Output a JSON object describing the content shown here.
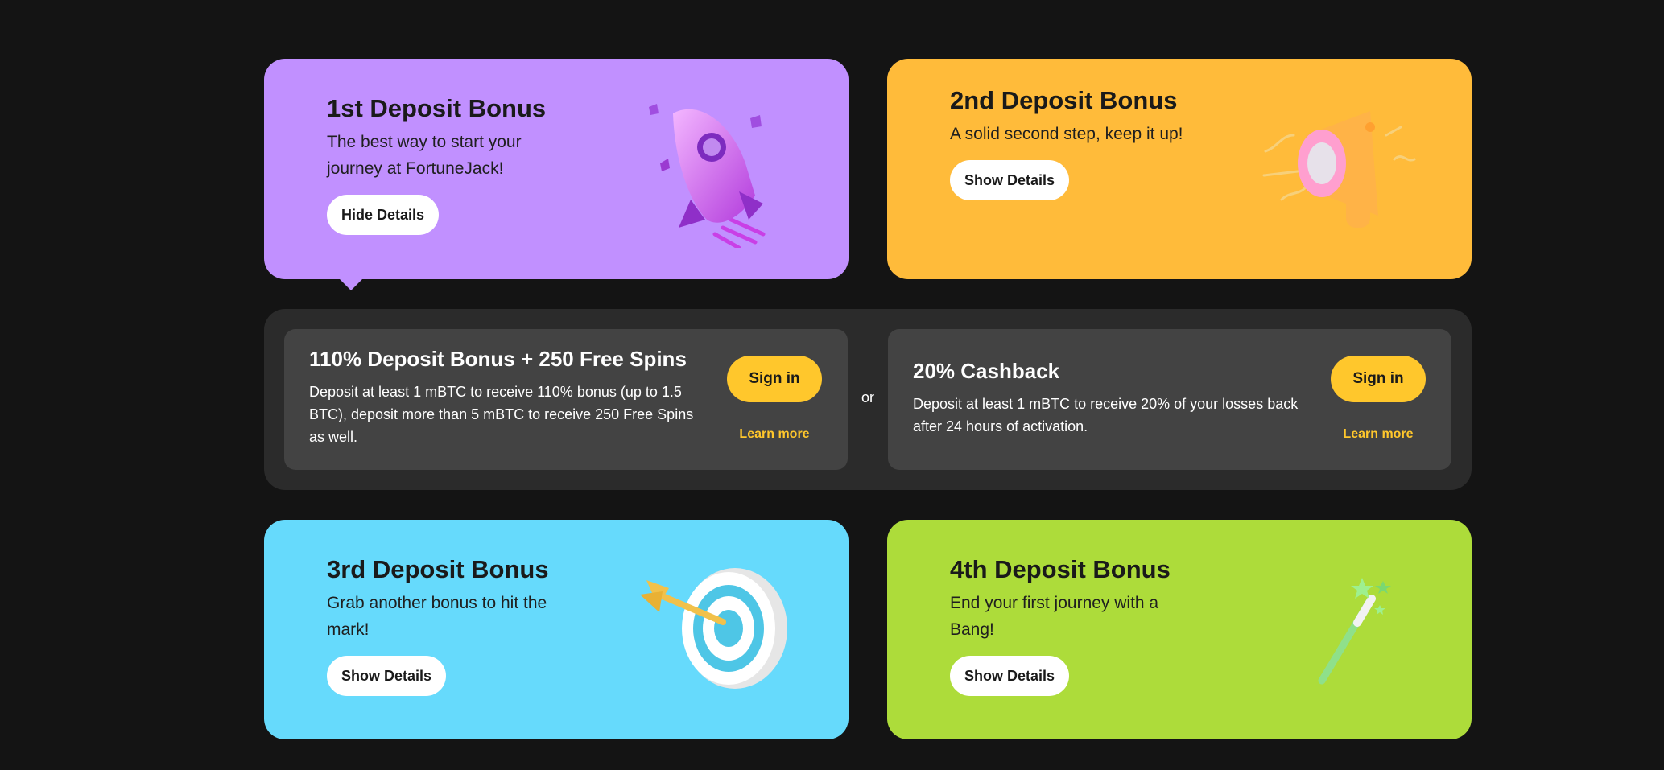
{
  "cards": [
    {
      "title": "1st Deposit Bonus",
      "desc": "The best way to start your journey at FortuneJack!",
      "button": "Hide Details",
      "icon": "rocket-icon",
      "color": "#c190ff"
    },
    {
      "title": "2nd Deposit Bonus",
      "desc": "A solid second step, keep it up!",
      "button": "Show Details",
      "icon": "megaphone-icon",
      "color": "#ffbb3a"
    },
    {
      "title": "3rd Deposit Bonus",
      "desc": "Grab another bonus to hit the mark!",
      "button": "Show Details",
      "icon": "target-icon",
      "color": "#66dafc"
    },
    {
      "title": "4th Deposit Bonus",
      "desc": "End your first journey with a Bang!",
      "button": "Show Details",
      "icon": "magic-wand-icon",
      "color": "#addc3a"
    }
  ],
  "details": {
    "separator": "or",
    "offers": [
      {
        "title": "110% Deposit Bonus + 250 Free Spins",
        "desc": "Deposit at least 1 mBTC to receive 110% bonus (up to 1.5 BTC), deposit more than 5 mBTC to receive 250 Free Spins as well.",
        "signin": "Sign in",
        "learn": "Learn more"
      },
      {
        "title": "20% Cashback",
        "desc": "Deposit at least 1 mBTC to receive 20% of your losses back after 24 hours of activation.",
        "signin": "Sign in",
        "learn": "Learn more"
      }
    ],
    "accent": "#ffc72c"
  }
}
